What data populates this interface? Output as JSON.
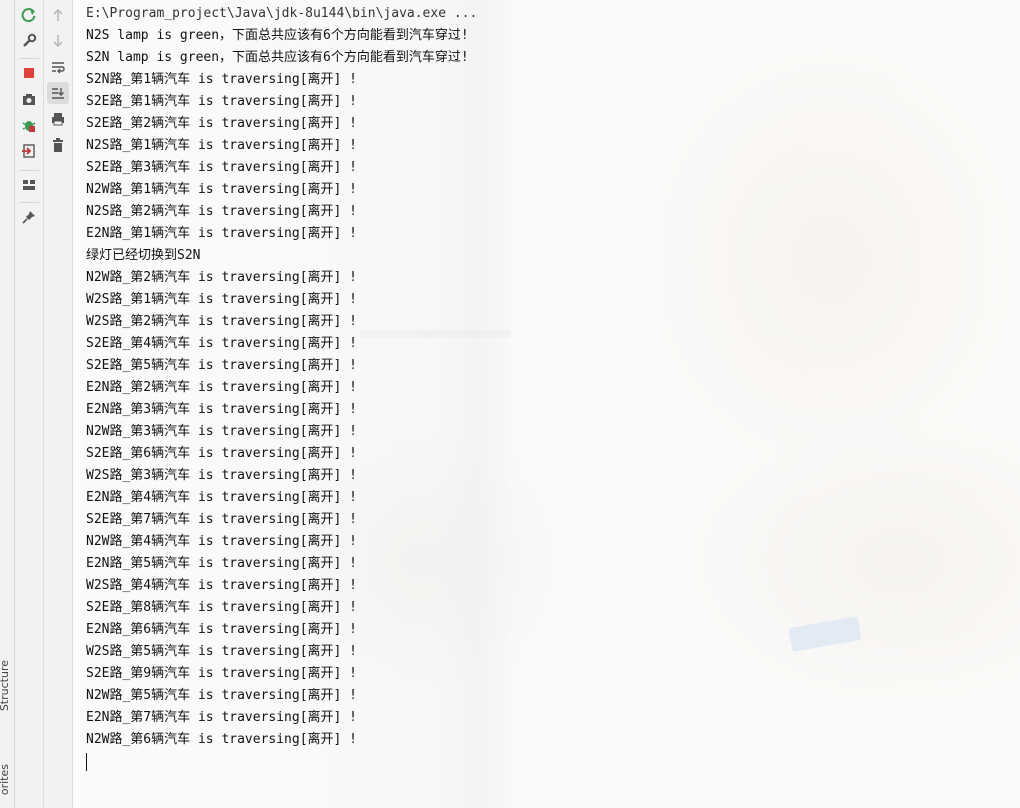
{
  "side_tabs": [
    "Structure",
    "orites"
  ],
  "console": {
    "command": "E:\\Program_project\\Java\\jdk-8u144\\bin\\java.exe ...",
    "lines": [
      "N2S lamp is green，下面总共应该有6个方向能看到汽车穿过!",
      "S2N lamp is green，下面总共应该有6个方向能看到汽车穿过!",
      "S2N路_第1辆汽车 is traversing[离开] !",
      "S2E路_第1辆汽车 is traversing[离开] !",
      "S2E路_第2辆汽车 is traversing[离开] !",
      "N2S路_第1辆汽车 is traversing[离开] !",
      "S2E路_第3辆汽车 is traversing[离开] !",
      "N2W路_第1辆汽车 is traversing[离开] !",
      "N2S路_第2辆汽车 is traversing[离开] !",
      "E2N路_第1辆汽车 is traversing[离开] !",
      "绿灯已经切换到S2N",
      "N2W路_第2辆汽车 is traversing[离开] !",
      "W2S路_第1辆汽车 is traversing[离开] !",
      "W2S路_第2辆汽车 is traversing[离开] !",
      "S2E路_第4辆汽车 is traversing[离开] !",
      "S2E路_第5辆汽车 is traversing[离开] !",
      "E2N路_第2辆汽车 is traversing[离开] !",
      "E2N路_第3辆汽车 is traversing[离开] !",
      "N2W路_第3辆汽车 is traversing[离开] !",
      "S2E路_第6辆汽车 is traversing[离开] !",
      "W2S路_第3辆汽车 is traversing[离开] !",
      "E2N路_第4辆汽车 is traversing[离开] !",
      "S2E路_第7辆汽车 is traversing[离开] !",
      "N2W路_第4辆汽车 is traversing[离开] !",
      "E2N路_第5辆汽车 is traversing[离开] !",
      "W2S路_第4辆汽车 is traversing[离开] !",
      "S2E路_第8辆汽车 is traversing[离开] !",
      "E2N路_第6辆汽车 is traversing[离开] !",
      "W2S路_第5辆汽车 is traversing[离开] !",
      "S2E路_第9辆汽车 is traversing[离开] !",
      "N2W路_第5辆汽车 is traversing[离开] !",
      "E2N路_第7辆汽车 is traversing[离开] !",
      "N2W路_第6辆汽车 is traversing[离开] !"
    ]
  },
  "toolbar_left": [
    {
      "name": "rerun-icon",
      "color": "#3d9a50"
    },
    {
      "name": "wrench-icon",
      "color": "#555555"
    },
    {
      "name": "stop-icon",
      "color": "#e0413c"
    },
    {
      "name": "camera-icon",
      "color": "#555555"
    },
    {
      "name": "debug-bug-icon",
      "color": "#3d9a50"
    },
    {
      "name": "exit-icon",
      "color": "#c2383a"
    },
    {
      "name": "layout-icon",
      "color": "#555555"
    },
    {
      "name": "pin-icon",
      "color": "#555555"
    }
  ],
  "toolbar_right": [
    {
      "name": "arrow-up-icon"
    },
    {
      "name": "arrow-down-icon"
    },
    {
      "name": "soft-wrap-icon"
    },
    {
      "name": "scroll-to-end-icon"
    },
    {
      "name": "print-icon"
    },
    {
      "name": "trash-icon"
    }
  ]
}
